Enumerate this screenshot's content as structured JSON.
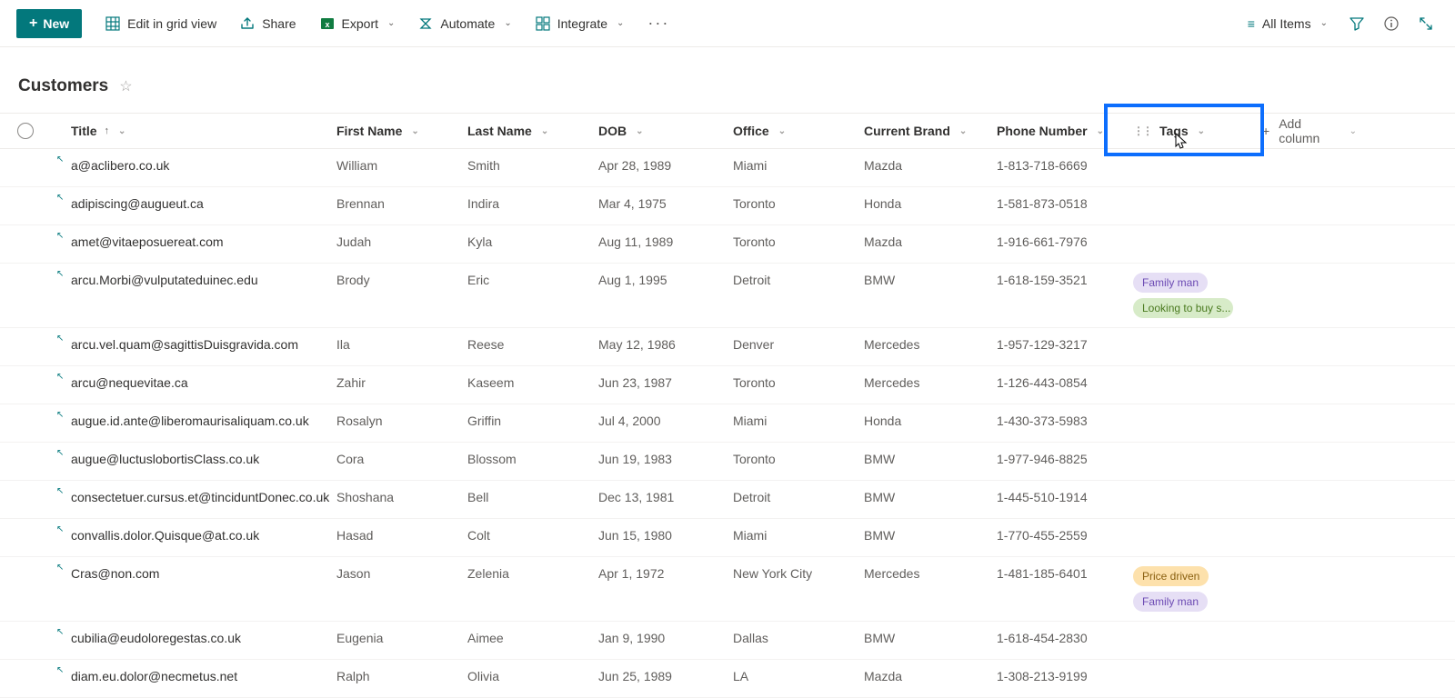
{
  "toolbar": {
    "new_label": "New",
    "edit_grid": "Edit in grid view",
    "share": "Share",
    "export": "Export",
    "automate": "Automate",
    "integrate": "Integrate",
    "view_name": "All Items"
  },
  "header": {
    "title": "Customers"
  },
  "columns": {
    "title": "Title",
    "first_name": "First Name",
    "last_name": "Last Name",
    "dob": "DOB",
    "office": "Office",
    "current_brand": "Current Brand",
    "phone": "Phone Number",
    "tags": "Tags",
    "add": "Add column"
  },
  "tags_palette": {
    "Family man": "tag-purple",
    "Looking to buy s...": "tag-green",
    "Price driven": "tag-orange"
  },
  "rows": [
    {
      "title": "a@aclibero.co.uk",
      "first_name": "William",
      "last_name": "Smith",
      "dob": "Apr 28, 1989",
      "office": "Miami",
      "brand": "Mazda",
      "phone": "1-813-718-6669",
      "tags": []
    },
    {
      "title": "adipiscing@augueut.ca",
      "first_name": "Brennan",
      "last_name": "Indira",
      "dob": "Mar 4, 1975",
      "office": "Toronto",
      "brand": "Honda",
      "phone": "1-581-873-0518",
      "tags": []
    },
    {
      "title": "amet@vitaeposuereat.com",
      "first_name": "Judah",
      "last_name": "Kyla",
      "dob": "Aug 11, 1989",
      "office": "Toronto",
      "brand": "Mazda",
      "phone": "1-916-661-7976",
      "tags": []
    },
    {
      "title": "arcu.Morbi@vulputateduinec.edu",
      "first_name": "Brody",
      "last_name": "Eric",
      "dob": "Aug 1, 1995",
      "office": "Detroit",
      "brand": "BMW",
      "phone": "1-618-159-3521",
      "tags": [
        "Family man",
        "Looking to buy s..."
      ]
    },
    {
      "title": "arcu.vel.quam@sagittisDuisgravida.com",
      "first_name": "Ila",
      "last_name": "Reese",
      "dob": "May 12, 1986",
      "office": "Denver",
      "brand": "Mercedes",
      "phone": "1-957-129-3217",
      "tags": []
    },
    {
      "title": "arcu@nequevitae.ca",
      "first_name": "Zahir",
      "last_name": "Kaseem",
      "dob": "Jun 23, 1987",
      "office": "Toronto",
      "brand": "Mercedes",
      "phone": "1-126-443-0854",
      "tags": []
    },
    {
      "title": "augue.id.ante@liberomaurisaliquam.co.uk",
      "first_name": "Rosalyn",
      "last_name": "Griffin",
      "dob": "Jul 4, 2000",
      "office": "Miami",
      "brand": "Honda",
      "phone": "1-430-373-5983",
      "tags": []
    },
    {
      "title": "augue@luctuslobortisClass.co.uk",
      "first_name": "Cora",
      "last_name": "Blossom",
      "dob": "Jun 19, 1983",
      "office": "Toronto",
      "brand": "BMW",
      "phone": "1-977-946-8825",
      "tags": []
    },
    {
      "title": "consectetuer.cursus.et@tinciduntDonec.co.uk",
      "first_name": "Shoshana",
      "last_name": "Bell",
      "dob": "Dec 13, 1981",
      "office": "Detroit",
      "brand": "BMW",
      "phone": "1-445-510-1914",
      "tags": []
    },
    {
      "title": "convallis.dolor.Quisque@at.co.uk",
      "first_name": "Hasad",
      "last_name": "Colt",
      "dob": "Jun 15, 1980",
      "office": "Miami",
      "brand": "BMW",
      "phone": "1-770-455-2559",
      "tags": []
    },
    {
      "title": "Cras@non.com",
      "first_name": "Jason",
      "last_name": "Zelenia",
      "dob": "Apr 1, 1972",
      "office": "New York City",
      "brand": "Mercedes",
      "phone": "1-481-185-6401",
      "tags": [
        "Price driven",
        "Family man"
      ]
    },
    {
      "title": "cubilia@eudoloregestas.co.uk",
      "first_name": "Eugenia",
      "last_name": "Aimee",
      "dob": "Jan 9, 1990",
      "office": "Dallas",
      "brand": "BMW",
      "phone": "1-618-454-2830",
      "tags": []
    },
    {
      "title": "diam.eu.dolor@necmetus.net",
      "first_name": "Ralph",
      "last_name": "Olivia",
      "dob": "Jun 25, 1989",
      "office": "LA",
      "brand": "Mazda",
      "phone": "1-308-213-9199",
      "tags": []
    }
  ]
}
